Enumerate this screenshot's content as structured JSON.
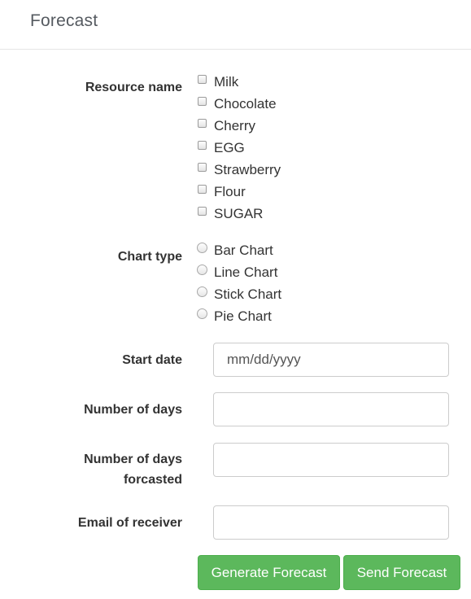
{
  "panel": {
    "title": "Forecast"
  },
  "form": {
    "resource_label": "Resource name",
    "resources": [
      "Milk",
      "Chocolate",
      "Cherry",
      "EGG",
      "Strawberry",
      "Flour",
      "SUGAR"
    ],
    "chart_type_label": "Chart type",
    "chart_types": [
      "Bar Chart",
      "Line Chart",
      "Stick Chart",
      "Pie Chart"
    ],
    "start_date_label": "Start date",
    "start_date_placeholder": "mm/dd/yyyy",
    "days_label": "Number of days",
    "days_forecasted_label_line1": "Number of days",
    "days_forecasted_label_line2": "forcasted",
    "email_label": "Email of receiver"
  },
  "buttons": {
    "generate": "Generate Forecast",
    "send": "Send Forecast"
  }
}
